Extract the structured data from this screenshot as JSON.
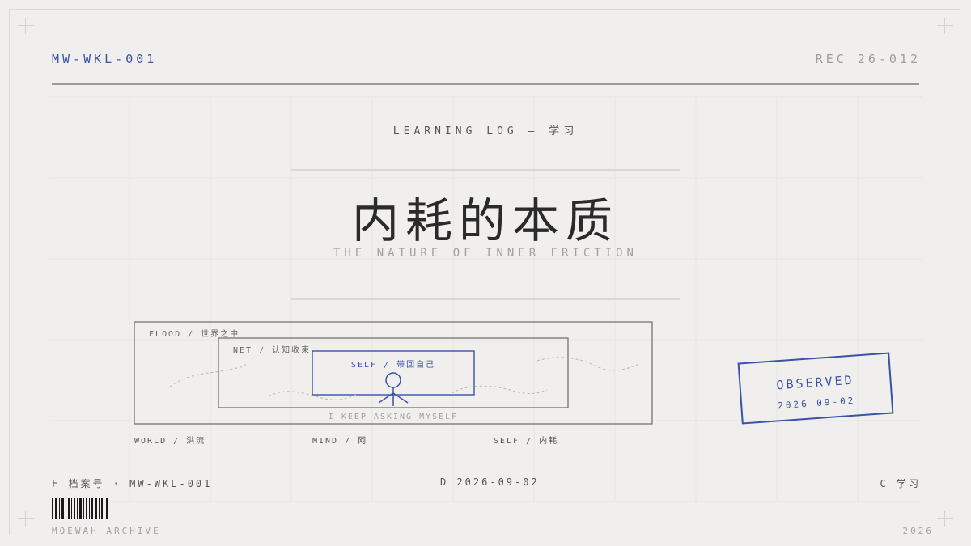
{
  "header": {
    "code": "MW-WKL-001",
    "record": "REC 26-012"
  },
  "eyebrow": "LEARNING LOG — 学习",
  "title": "内耗的本质",
  "subtitle": "THE NATURE OF INNER FRICTION",
  "diagram": {
    "flood_label": "FLOOD / 世界之中",
    "net_label": "NET / 认知收束",
    "self_label": "SELF / 带回自己",
    "caption": "I KEEP ASKING MYSELF",
    "legend": [
      "WORLD / 洪流",
      "MIND / 网",
      "SELF / 内耗"
    ]
  },
  "stamp": {
    "label": "OBSERVED",
    "date": "2026-09-02"
  },
  "footer": {
    "file": "F 档案号 · MW-WKL-001",
    "date": "D 2026-09-02",
    "category": "C 学习",
    "archive": "MOEWAH ARCHIVE",
    "year": "2026"
  },
  "colors": {
    "accent": "#3a53a8",
    "background": "#f0efed",
    "ink": "#2a2a2a"
  }
}
